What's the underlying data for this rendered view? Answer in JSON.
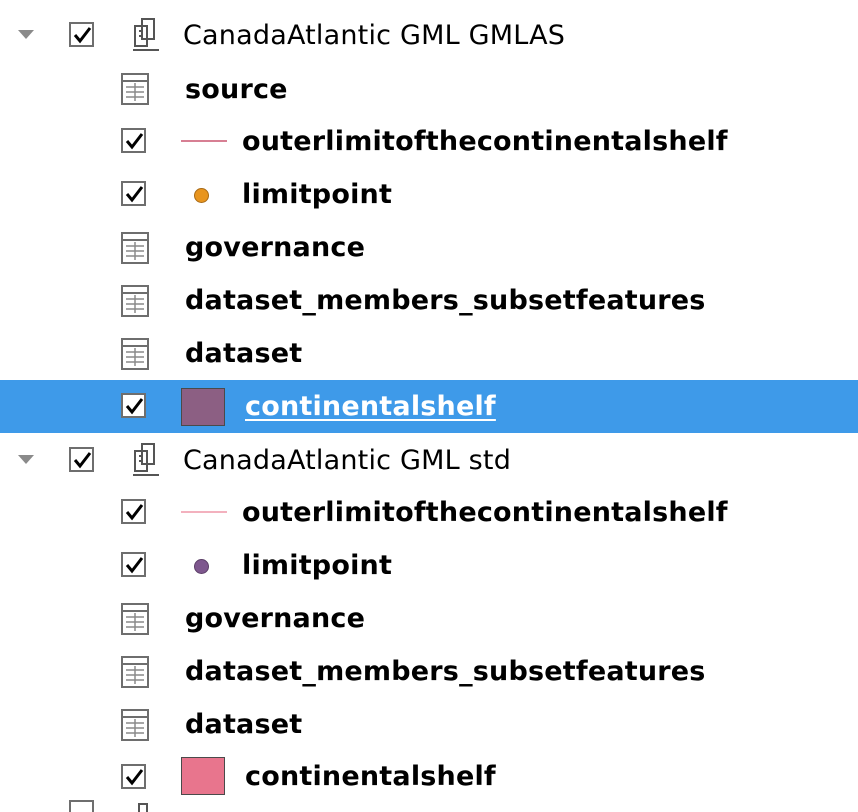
{
  "tree": {
    "group1": {
      "label": "CanadaAtlantic GML GMLAS",
      "children": {
        "source": "source",
        "outer_limit": "outerlimitofthecontinentalshelf",
        "limitpoint": "limitpoint",
        "governance": "governance",
        "dataset_members": "dataset_members_subsetfeatures",
        "dataset": "dataset",
        "continentalshelf": "continentalshelf"
      },
      "colors": {
        "outer_limit_line": "#d77f93",
        "limitpoint_dot": "#e8951f",
        "continentalshelf_fill": "#8c5f83"
      }
    },
    "group2": {
      "label": "CanadaAtlantic GML std",
      "children": {
        "outer_limit": "outerlimitofthecontinentalshelf",
        "limitpoint": "limitpoint",
        "governance": "governance",
        "dataset_members": "dataset_members_subsetfeatures",
        "dataset": "dataset",
        "continentalshelf": "continentalshelf"
      },
      "colors": {
        "outer_limit_line": "#f3b1be",
        "limitpoint_dot": "#7e578e",
        "continentalshelf_fill": "#e8758d"
      }
    },
    "selection_color": "#3e9ae9",
    "icons": {
      "expand": "chevron-down-icon",
      "group": "layer-group-icon",
      "table": "table-icon",
      "check": "checkmark-icon"
    }
  }
}
